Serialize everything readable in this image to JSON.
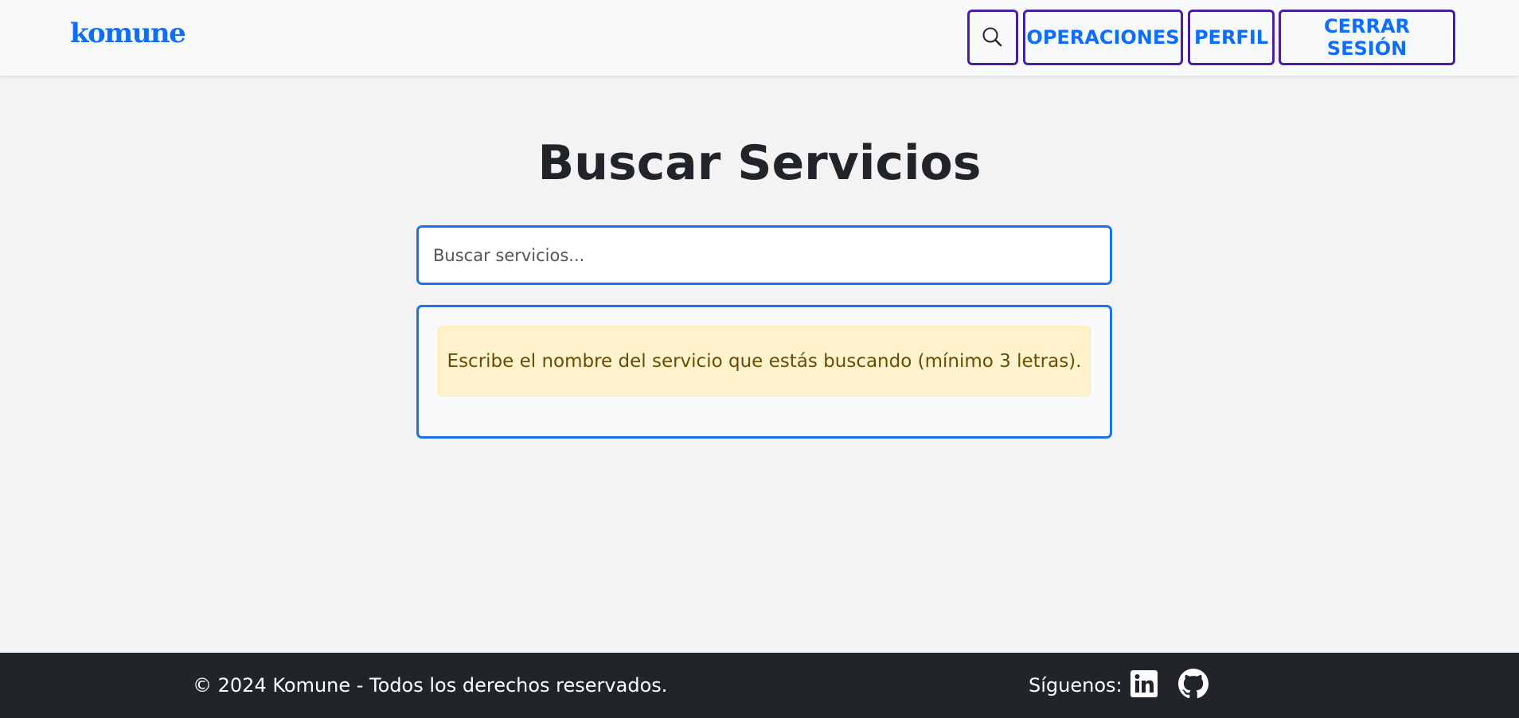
{
  "header": {
    "brand": "komune",
    "search_icon": "search-icon",
    "nav": {
      "operations": "OPERACIONES",
      "profile": "PERFIL",
      "logout": "CERRAR SESIÓN"
    }
  },
  "main": {
    "title": "Buscar Servicios",
    "search": {
      "value": "",
      "placeholder": "Buscar servicios..."
    },
    "alert": "Escribe el nombre del servicio que estás buscando (mínimo 3 letras)."
  },
  "footer": {
    "copyright": "© 2024 Komune - Todos los derechos reservados.",
    "follow_label": "Síguenos:",
    "social": [
      "linkedin-icon",
      "github-icon"
    ]
  },
  "colors": {
    "accent": "#0d6efd",
    "nav_border": "#4a1fa8",
    "input_border": "#1a73e8",
    "alert_bg": "#fff3cd",
    "alert_text": "#664d03",
    "footer_bg": "#212529",
    "page_bg": "#f3f3f3"
  }
}
